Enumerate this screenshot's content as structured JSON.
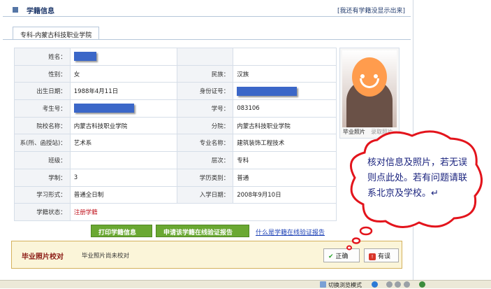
{
  "header": {
    "title": "学籍信息",
    "link": "[我还有学籍没显示出来]"
  },
  "tab": {
    "label": "专科-内蒙古科技职业学院"
  },
  "rows": [
    {
      "l1": "姓名：",
      "v1": "",
      "v1_masked": true
    },
    {
      "l1": "性别：",
      "v1": "女",
      "l2": "民族：",
      "v2": "汉族"
    },
    {
      "l1": "出生日期：",
      "v1": "1988年4月11日",
      "l2": "身份证号：",
      "v2": "",
      "v2_masked": true
    },
    {
      "l1": "考生号：",
      "v1": "",
      "v1_masked": true,
      "l2": "学号：",
      "v2": "083106"
    },
    {
      "l1": "院校名称：",
      "v1": "内蒙古科技职业学院",
      "l2": "分院：",
      "v2": "内蒙古科技职业学院"
    },
    {
      "l1": "系(所、函授站)：",
      "v1": "艺术系",
      "l2": "专业名称：",
      "v2": "建筑装饰工程技术"
    },
    {
      "l1": "班级：",
      "v1": "",
      "l2": "层次：",
      "v2": "专科"
    },
    {
      "l1": "学制：",
      "v1": "3",
      "l2": "学历类别：",
      "v2": "普通"
    },
    {
      "l1": "学习形式：",
      "v1": "普通全日制",
      "l2": "入学日期：",
      "v2": "2008年9月10日"
    },
    {
      "l1": "学籍状态：",
      "v1": "注册学籍"
    }
  ],
  "photo": {
    "caption": "毕业照片",
    "caption2": "录取照片"
  },
  "buttons": {
    "print": "打印学籍信息",
    "apply": "申请该学籍在线验证报告",
    "what_link": "什么是学籍在线验证报告"
  },
  "check": {
    "title": "毕业照片校对",
    "text": "毕业照片尚未校对",
    "ok": "正确",
    "bad": "有误"
  },
  "callout": {
    "text": "核对信息及照片，若无误则点此处。若有问题请联系北京及学校。↵"
  },
  "statusbar": {
    "text": "切换浏览模式"
  }
}
